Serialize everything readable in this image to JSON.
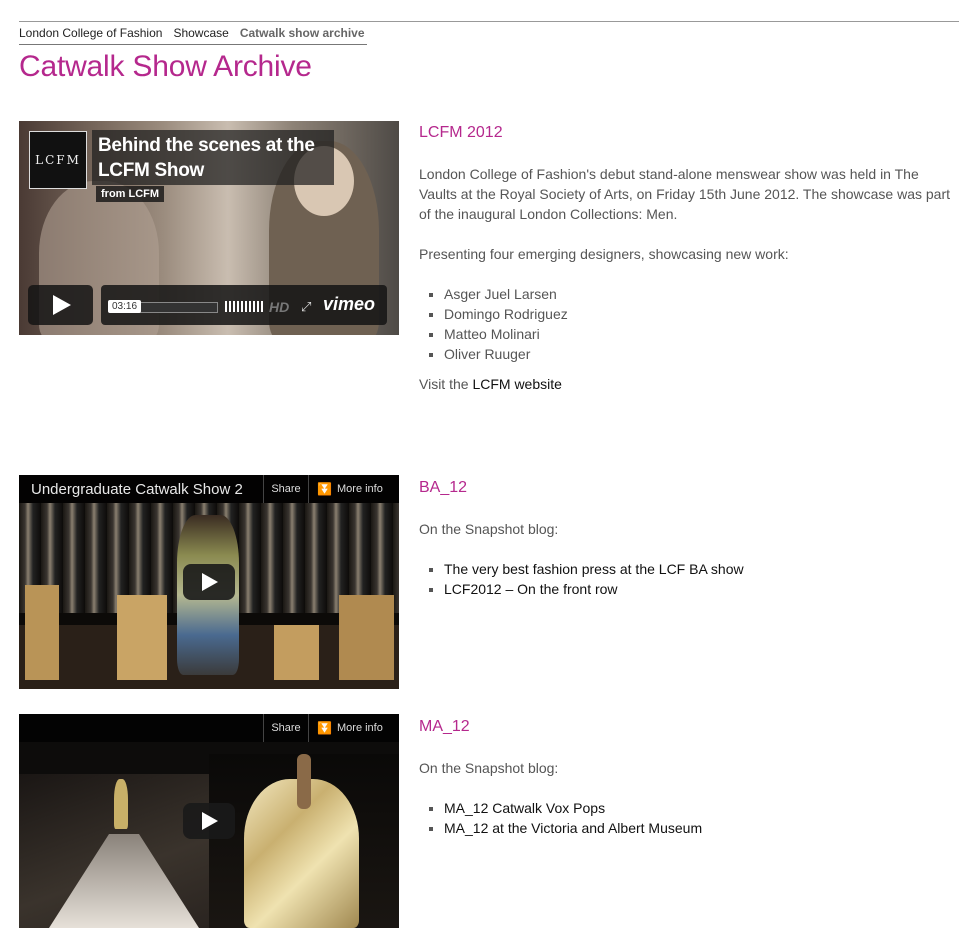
{
  "breadcrumb": {
    "items": [
      "London College of Fashion",
      "Showcase"
    ],
    "current": "Catwalk show archive"
  },
  "page_title": "Catwalk Show Archive",
  "video1": {
    "logo": "LCFM",
    "title": "Behind the scenes at the LCFM Show",
    "from": "from LCFM",
    "time": "03:16",
    "hd": "HD",
    "brand": "vimeo"
  },
  "video2": {
    "title": "Undergraduate Catwalk Show 2",
    "share": "Share",
    "more_info": "More info"
  },
  "video3": {
    "share": "Share",
    "more_info": "More info"
  },
  "entry1": {
    "heading": "LCFM 2012",
    "paragraph": "London College of Fashion's debut stand-alone menswear show was held in The Vaults at the Royal Society of Arts, on Friday 15th June 2012. The showcase was part of the inaugural London Collections: Men.",
    "intro": "Presenting four emerging designers, showcasing new work:",
    "designers": [
      "Asger Juel Larsen",
      "Domingo Rodriguez",
      "Matteo Molinari",
      "Oliver Ruuger"
    ],
    "visit_prefix": "Visit the",
    "visit_link": "LCFM website"
  },
  "entry2": {
    "heading": "BA_12",
    "intro": "On the Snapshot blog:",
    "links": [
      "The very best fashion press at the LCF BA show",
      "LCF2012 – On the front row"
    ]
  },
  "entry3": {
    "heading": "MA_12",
    "intro": "On the Snapshot blog:",
    "links": [
      "MA_12 Catwalk Vox Pops",
      "MA_12 at the Victoria and Albert Museum"
    ]
  },
  "colors": {
    "accent": "#b5288d",
    "text": "#555555"
  }
}
